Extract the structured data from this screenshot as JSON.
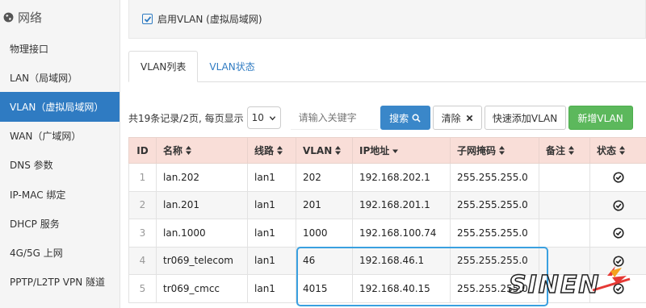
{
  "sidebar": {
    "title": "网络",
    "items": [
      {
        "label": "物理接口"
      },
      {
        "label": "LAN（局域网）"
      },
      {
        "label": "VLAN（虚拟局域网）"
      },
      {
        "label": "WAN（广域网）"
      },
      {
        "label": "DNS 参数"
      },
      {
        "label": "IP-MAC 绑定"
      },
      {
        "label": "DHCP 服务"
      },
      {
        "label": "4G/5G 上网"
      },
      {
        "label": "PPTP/L2TP VPN 隧道"
      }
    ],
    "active_index": 2
  },
  "vlan_enable": {
    "label": "启用VLAN (虚拟局域网)",
    "checked": true
  },
  "tabs": [
    {
      "label": "VLAN列表",
      "active": true
    },
    {
      "label": "VLAN状态",
      "active": false
    }
  ],
  "toolbar": {
    "records_text": "共19条记录/2页, 每页显示",
    "page_size": "10",
    "search_placeholder": "请输入关键字",
    "search_label": "搜索",
    "clear_label": "清除",
    "quick_add_label": "快速添加VLAN",
    "add_label": "新增VLAN"
  },
  "table": {
    "headers": {
      "id": "ID",
      "name": "名称",
      "line": "线路",
      "vlan": "VLAN",
      "ip": "IP地址",
      "mask": "子网掩码",
      "remark": "备注",
      "status": "状态"
    },
    "rows": [
      {
        "id": "1",
        "name": "lan.202",
        "line": "lan1",
        "vlan": "202",
        "ip": "192.168.202.1",
        "mask": "255.255.255.0",
        "remark": "",
        "status": "enabled"
      },
      {
        "id": "2",
        "name": "lan.201",
        "line": "lan1",
        "vlan": "201",
        "ip": "192.168.201.1",
        "mask": "255.255.255.0",
        "remark": "",
        "status": "enabled"
      },
      {
        "id": "3",
        "name": "lan.1000",
        "line": "lan1",
        "vlan": "1000",
        "ip": "192.168.100.74",
        "mask": "255.255.255.0",
        "remark": "",
        "status": "enabled"
      },
      {
        "id": "4",
        "name": "tr069_telecom",
        "line": "lan1",
        "vlan": "46",
        "ip": "192.168.46.1",
        "mask": "255.255.255.0",
        "remark": "",
        "status": "enabled"
      },
      {
        "id": "5",
        "name": "tr069_cmcc",
        "line": "lan1",
        "vlan": "4015",
        "ip": "192.168.40.15",
        "mask": "255.255.255.0",
        "remark": "",
        "status": "enabled"
      }
    ]
  },
  "watermark": {
    "text": "SINEN"
  },
  "colors": {
    "accent": "#2f7bc2",
    "header_bg": "#f9ded8",
    "add_button": "#5cb85c",
    "highlight": "#3aa0e0"
  }
}
